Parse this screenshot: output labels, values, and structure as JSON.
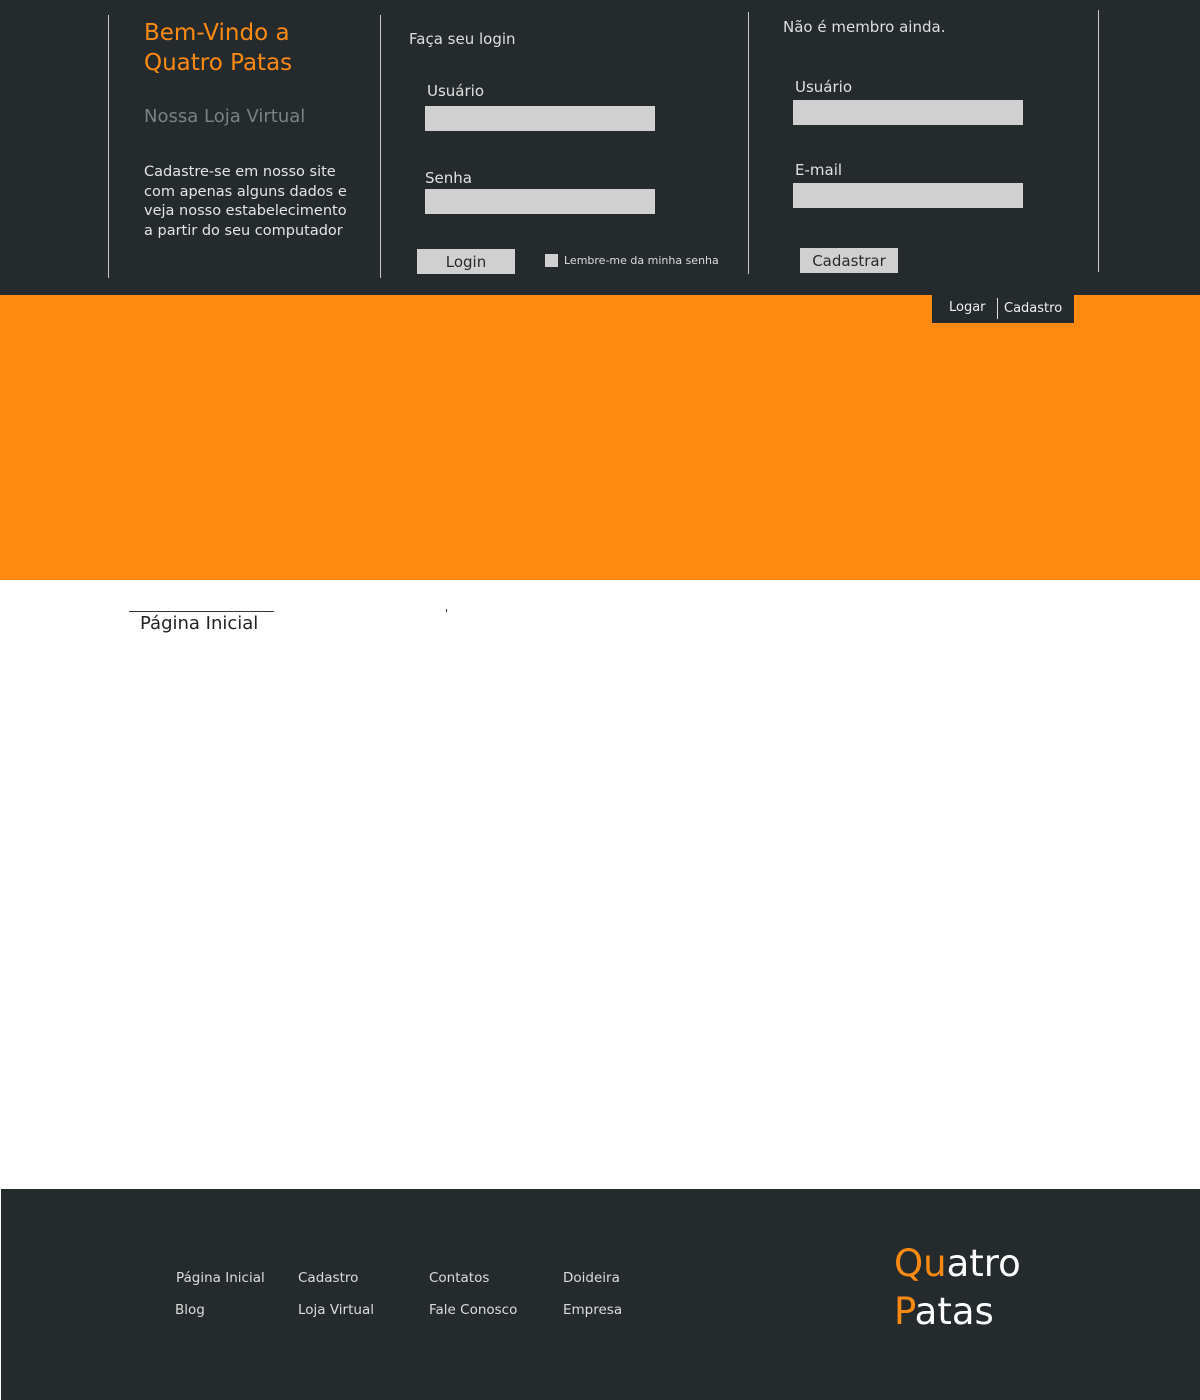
{
  "welcome": {
    "title_line1": "Bem-Vindo a",
    "title_line2": "Quatro Patas",
    "subtitle": "Nossa Loja Virtual",
    "text": "Cadastre-se em nosso site com apenas alguns dados e veja nosso estabelecimento a partir do seu computador"
  },
  "login": {
    "heading": "Faça seu login",
    "user_label": "Usuário",
    "user_value": "",
    "password_label": "Senha",
    "password_value": "",
    "button_label": "Login",
    "remember_label": "Lembre-me da minha senha",
    "remember_checked": false
  },
  "register": {
    "heading": "Não é membro ainda.",
    "user_label": "Usuário",
    "user_value": "",
    "email_label": "E-mail",
    "email_value": "",
    "button_label": "Cadastrar"
  },
  "tabs": {
    "logar": "Logar",
    "cadastro": "Cadastro"
  },
  "page": {
    "title": "Página Inicial"
  },
  "footer": {
    "links": {
      "pagina_inicial": "Página Inicial",
      "blog": "Blog",
      "cadastro": "Cadastro",
      "loja_virtual": "Loja Virtual",
      "contatos": "Contatos",
      "fale_conosco": "Fale Conosco",
      "doideira": "Doideira",
      "empresa": "Empresa"
    },
    "logo": {
      "line1_accent": "Qu",
      "line1_rest": "atro",
      "line2_accent": "P",
      "line2_rest": "atas"
    }
  },
  "colors": {
    "dark_bg": "#252b2c",
    "accent_orange": "#ff8a12",
    "field_gray": "#d0d0d0",
    "muted_text": "#7c8284"
  }
}
